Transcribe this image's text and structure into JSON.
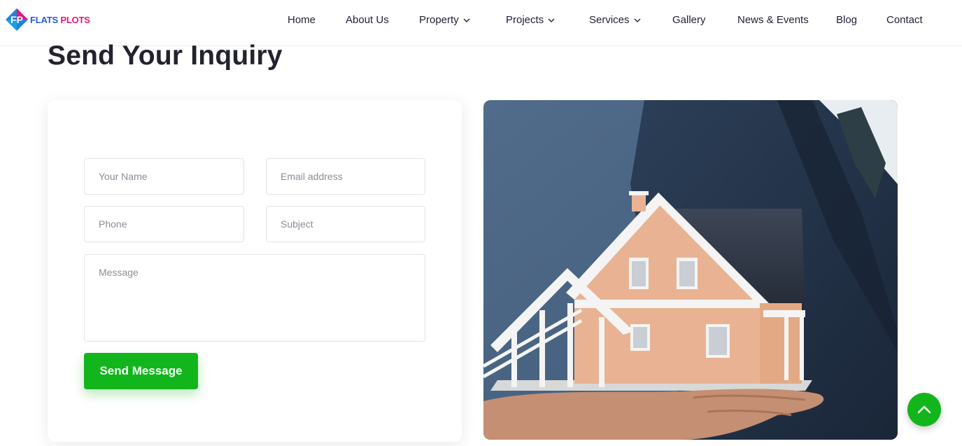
{
  "brand": {
    "word1": "FLATS",
    "word2": "PLOTS",
    "mark": "FP"
  },
  "nav": {
    "home": "Home",
    "about": "About Us",
    "property": "Property",
    "projects": "Projects",
    "services": "Services",
    "gallery": "Gallery",
    "news": "News & Events",
    "blog": "Blog",
    "contact": "Contact"
  },
  "page": {
    "title": "Send Your Inquiry"
  },
  "form": {
    "name_placeholder": "Your Name",
    "email_placeholder": "Email address",
    "phone_placeholder": "Phone",
    "subject_placeholder": "Subject",
    "message_placeholder": "Message",
    "submit_label": "Send Message"
  },
  "icons": {
    "dropdown": "chevron-down-icon",
    "scroll_top": "chevron-up-icon"
  },
  "colors": {
    "accent": "#12b51c",
    "brand_blue": "#2a5bd7",
    "brand_pink": "#e2187b",
    "text_dark": "#23232f"
  }
}
